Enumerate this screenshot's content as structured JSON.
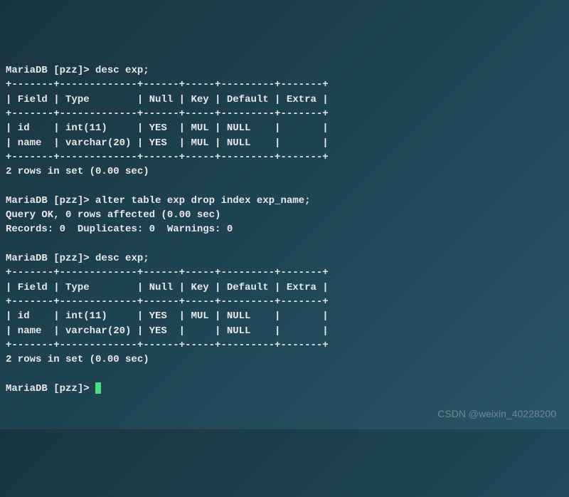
{
  "prompt": "MariaDB [pzz]> ",
  "cmd1": "desc exp;",
  "table1_border_top": "+-------+-------------+------+-----+---------+-------+",
  "table1_header": "| Field | Type        | Null | Key | Default | Extra |",
  "table1_border_mid": "+-------+-------------+------+-----+---------+-------+",
  "table1_row1": "| id    | int(11)     | YES  | MUL | NULL    |       |",
  "table1_row2": "| name  | varchar(20) | YES  | MUL | NULL    |       |",
  "table1_border_bot": "+-------+-------------+------+-----+---------+-------+",
  "result1": "2 rows in set (0.00 sec)",
  "cmd2": "alter table exp drop index exp_name;",
  "result2a": "Query OK, 0 rows affected (0.00 sec)",
  "result2b": "Records: 0  Duplicates: 0  Warnings: 0",
  "cmd3": "desc exp;",
  "table2_border_top": "+-------+-------------+------+-----+---------+-------+",
  "table2_header": "| Field | Type        | Null | Key | Default | Extra |",
  "table2_border_mid": "+-------+-------------+------+-----+---------+-------+",
  "table2_row1": "| id    | int(11)     | YES  | MUL | NULL    |       |",
  "table2_row2": "| name  | varchar(20) | YES  |     | NULL    |       |",
  "table2_border_bot": "+-------+-------------+------+-----+---------+-------+",
  "result3": "2 rows in set (0.00 sec)",
  "watermark": "CSDN @weixin_40228200"
}
